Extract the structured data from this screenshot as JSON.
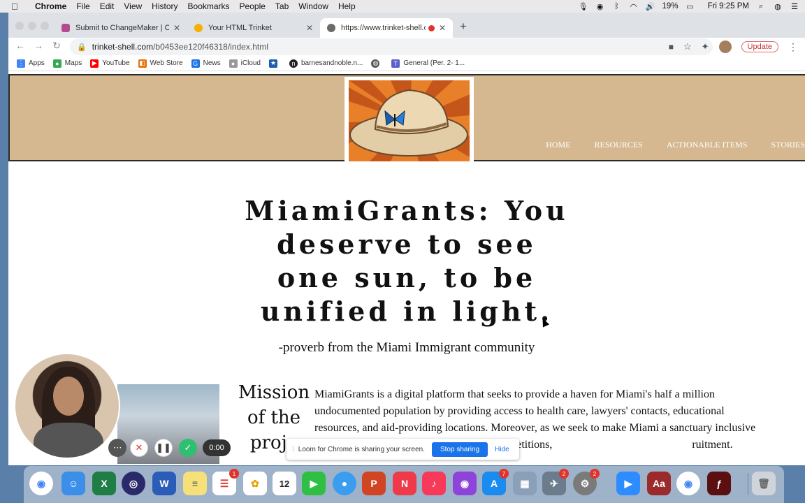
{
  "menubar": {
    "items": [
      "Chrome",
      "File",
      "Edit",
      "View",
      "History",
      "Bookmarks",
      "People",
      "Tab",
      "Window",
      "Help"
    ],
    "battery": "19%",
    "clock": "Fri 9:25 PM"
  },
  "browser": {
    "tabs": [
      {
        "title": "Submit to ChangeMaker | Code",
        "color": "#b64a8e"
      },
      {
        "title": "Your HTML Trinket",
        "color": "#f3b200"
      },
      {
        "title": "https://www.trinket-shell.com",
        "color": "#6b6b6b"
      }
    ],
    "url_host": "trinket-shell.com",
    "url_path": "/b0453ee120f46318/index.html",
    "update_label": "Update",
    "bookmarks": [
      "Apps",
      "Maps",
      "YouTube",
      "Web Store",
      "News",
      "iCloud",
      "",
      "barnesandnoble.n...",
      "",
      "General (Per. 2- 1..."
    ]
  },
  "site": {
    "nav": [
      "HOME",
      "RESOURCES",
      "ACTIONABLE ITEMS",
      "STORIES"
    ],
    "headline_lines": [
      "MiamiGrants: You",
      "deserve to see",
      "one sun, to be",
      "unified in light."
    ],
    "proverb": "-proverb from the Miami Immigrant community",
    "mission_title_lines": [
      "Mission",
      "of the",
      "proje"
    ],
    "mission_text": "MiamiGrants is a digital platform that seeks to provide a haven for Miami's half a million undocumented population by providing access to health care, lawyers' contacts, educational resources, and aid-providing locations. Moreover, as we seek to make Miami a sanctuary inclusive for all, we provide actionable items such as petitions,                                                  ruitment."
  },
  "loom": {
    "timer": "0:00",
    "share_text": "Loom for Chrome is sharing your screen.",
    "stop_label": "Stop sharing",
    "hide_label": "Hide"
  },
  "dock": {
    "calendar_day": "12",
    "badges": {
      "reminders": "1",
      "appstore": "7",
      "preview": "2",
      "settings": "2"
    }
  },
  "colors": {
    "header_tan": "#d6b890",
    "sun_orange": "#e8802a",
    "chrome_blue": "#1a73e8"
  }
}
